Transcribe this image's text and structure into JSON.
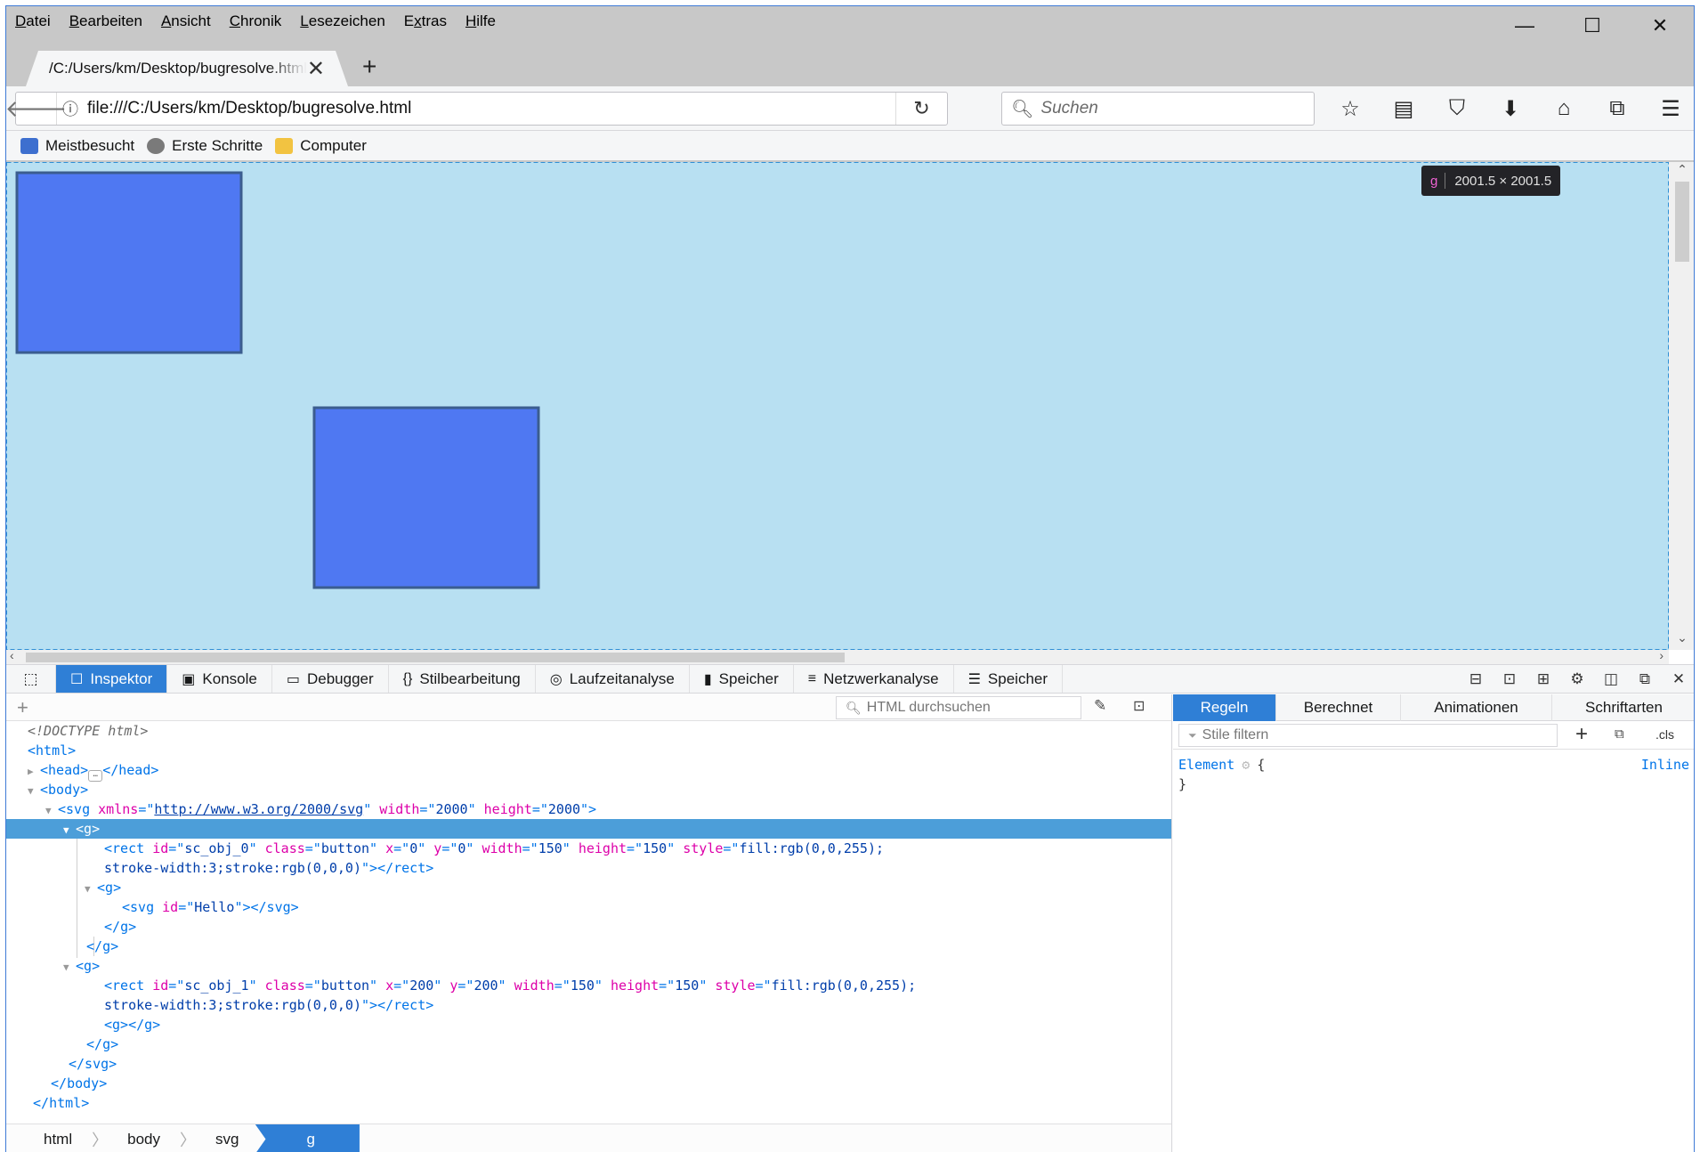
{
  "menubar": {
    "items": [
      {
        "accel": "D",
        "rest": "atei"
      },
      {
        "accel": "B",
        "rest": "earbeiten"
      },
      {
        "accel": "A",
        "rest": "nsicht"
      },
      {
        "accel": "C",
        "rest": "hronik"
      },
      {
        "accel": "L",
        "rest": "esezeichen"
      },
      {
        "pre": "E",
        "accel": "x",
        "rest": "tras"
      },
      {
        "accel": "H",
        "rest": "ilfe"
      }
    ],
    "minimize": "—",
    "maximize": "☐",
    "close": "✕"
  },
  "tab": {
    "title": "/C:/Users/km/Desktop/bugresolve.html",
    "close": "✕",
    "new": "+"
  },
  "navbar": {
    "back": "🡐",
    "info": "ⓘ",
    "url": "file:///C:/Users/km/Desktop/bugresolve.html",
    "reload": "↻",
    "search_icon": "🔍︎",
    "search_placeholder": "Suchen",
    "tools": [
      "☆",
      "▤",
      "⛉",
      "⬇",
      "⌂",
      "⧉",
      "☰"
    ]
  },
  "bookmarks": [
    {
      "label": "Meistbesucht",
      "color": "#3d6fcf"
    },
    {
      "label": "Erste Schritte",
      "color": "#7a7a7a"
    },
    {
      "label": "Computer",
      "color": "#f2c341"
    }
  ],
  "content": {
    "background": "#b8e0f2",
    "rect_fill": "#4f78f2",
    "rect_stroke": "#3b5d8f",
    "tooltip": {
      "tag": "g",
      "size": "2001.5 × 2001.5"
    }
  },
  "devtools": {
    "tabs": [
      {
        "label": "Inspektor",
        "icon": "☐",
        "active": true
      },
      {
        "label": "Konsole",
        "icon": "▣"
      },
      {
        "label": "Debugger",
        "icon": "▭"
      },
      {
        "label": "Stilbearbeitung",
        "icon": "{}"
      },
      {
        "label": "Laufzeitanalyse",
        "icon": "◎"
      },
      {
        "label": "Speicher",
        "icon": "▮"
      },
      {
        "label": "Netzwerkanalyse",
        "icon": "≡"
      },
      {
        "label": "Speicher",
        "icon": "☰"
      }
    ],
    "picker_icon": "⬚",
    "tools": [
      "⊟",
      "⊡",
      "⊞",
      "⚙",
      "◫",
      "⧉",
      "✕"
    ],
    "markup": {
      "add": "+",
      "search_placeholder": "HTML durchsuchen",
      "search_icon": "🔍︎",
      "eyedropper": "✎",
      "sidebar": "⊡",
      "lines": {
        "doctype": "<!DOCTYPE html>",
        "html_open": "html",
        "head": "head",
        "body_open": "body",
        "svg_xmlns_name": "xmlns",
        "svg_xmlns_val": "http://www.w3.org/2000/svg",
        "svg_width_val": "2000",
        "svg_height_val": "2000",
        "g": "g",
        "rect0_id": "sc_obj_0",
        "rect1_id": "sc_obj_1",
        "rect_class": "button",
        "rect0_x": "0",
        "rect0_y": "0",
        "rect1_x": "200",
        "rect1_y": "200",
        "rect_w": "150",
        "rect_h": "150",
        "rect_style_a": "fill:rgb(0,0,255);",
        "rect_style_b": "stroke-width:3;stroke:rgb(0,0,0)",
        "inner_svg_id": "Hello"
      },
      "breadcrumbs": [
        "html",
        "body",
        "svg",
        "g"
      ]
    },
    "rules": {
      "tabs": [
        "Regeln",
        "Berechnet",
        "Animationen",
        "Schriftarten"
      ],
      "filter_placeholder": "Stile filtern",
      "filter_icon": "⏷",
      "add": "+",
      "pseudo": "⧉",
      "cls": ".cls",
      "selector": "Element",
      "gear": "⚙",
      "open": "{",
      "close": "}",
      "source": "Inline"
    }
  }
}
